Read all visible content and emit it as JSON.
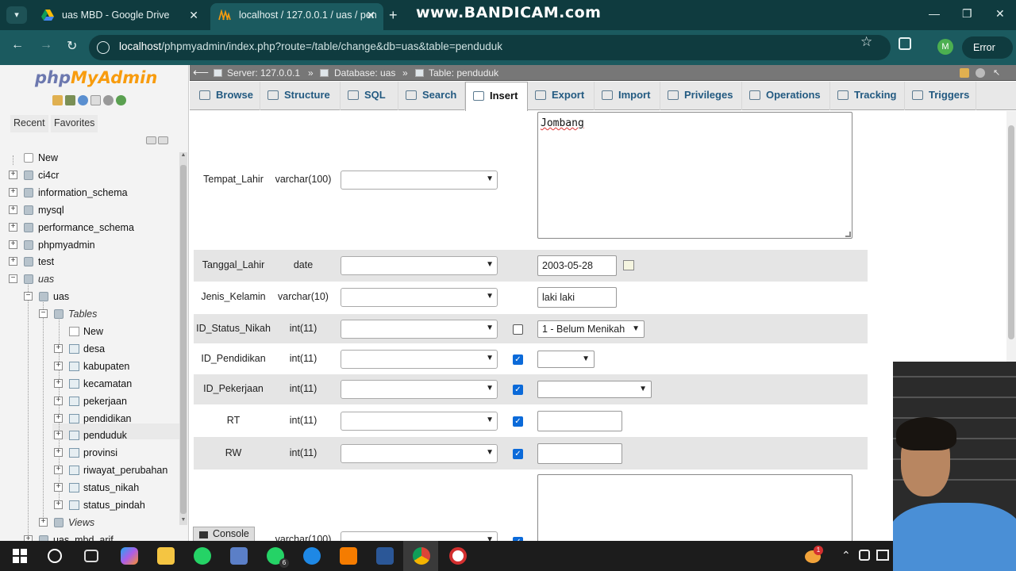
{
  "browser": {
    "tabs": [
      {
        "title": "uas MBD - Google Drive",
        "active": false
      },
      {
        "title": "localhost / 127.0.0.1 / uas / pen",
        "active": true
      }
    ],
    "watermark": "www.BANDICAM.com",
    "url_host": "localhost",
    "url_path": "/phpmyadmin/index.php?route=/table/change&db=uas&table=penduduk",
    "profile_initial": "M",
    "error_label": "Error"
  },
  "sidebar": {
    "logo_php": "php",
    "logo_my": "MyAdmin",
    "tabs": [
      "Recent",
      "Favorites"
    ],
    "tree": [
      {
        "label": "New",
        "level": 0
      },
      {
        "label": "ci4cr",
        "level": 0
      },
      {
        "label": "information_schema",
        "level": 0
      },
      {
        "label": "mysql",
        "level": 0
      },
      {
        "label": "performance_schema",
        "level": 0
      },
      {
        "label": "phpmyadmin",
        "level": 0
      },
      {
        "label": "test",
        "level": 0
      },
      {
        "label": "uas",
        "level": 0,
        "italic": true
      },
      {
        "label": "uas",
        "level": 1
      },
      {
        "label": "Tables",
        "level": 2,
        "italic": true
      },
      {
        "label": "New",
        "level": 3
      },
      {
        "label": "desa",
        "level": 3
      },
      {
        "label": "kabupaten",
        "level": 3
      },
      {
        "label": "kecamatan",
        "level": 3
      },
      {
        "label": "pekerjaan",
        "level": 3
      },
      {
        "label": "pendidikan",
        "level": 3
      },
      {
        "label": "penduduk",
        "level": 3,
        "selected": true
      },
      {
        "label": "provinsi",
        "level": 3
      },
      {
        "label": "riwayat_perubahan",
        "level": 3
      },
      {
        "label": "status_nikah",
        "level": 3
      },
      {
        "label": "status_pindah",
        "level": 3
      },
      {
        "label": "Views",
        "level": 2,
        "italic": true
      },
      {
        "label": "uas_mbd_arif",
        "level": 1
      }
    ]
  },
  "breadcrumb": {
    "server": "Server: 127.0.0.1",
    "database": "Database: uas",
    "table": "Table: penduduk",
    "sep": "»"
  },
  "tabs": [
    "Browse",
    "Structure",
    "SQL",
    "Search",
    "Insert",
    "Export",
    "Import",
    "Privileges",
    "Operations",
    "Tracking",
    "Triggers"
  ],
  "active_tab": "Insert",
  "form_rows": [
    {
      "name": "Tempat_Lahir",
      "type": "varchar(100)",
      "null": null,
      "value": "Jombang",
      "kind": "textarea"
    },
    {
      "name": "Tanggal_Lahir",
      "type": "date",
      "null": null,
      "value": "2003-05-28",
      "kind": "date"
    },
    {
      "name": "Jenis_Kelamin",
      "type": "varchar(10)",
      "null": null,
      "value": "laki laki",
      "kind": "text"
    },
    {
      "name": "ID_Status_Nikah",
      "type": "int(11)",
      "null": false,
      "value": "1 - Belum Menikah",
      "kind": "select"
    },
    {
      "name": "ID_Pendidikan",
      "type": "int(11)",
      "null": true,
      "value": "",
      "kind": "select-small"
    },
    {
      "name": "ID_Pekerjaan",
      "type": "int(11)",
      "null": true,
      "value": "",
      "kind": "select-mid"
    },
    {
      "name": "RT",
      "type": "int(11)",
      "null": true,
      "value": "",
      "kind": "text"
    },
    {
      "name": "RW",
      "type": "int(11)",
      "null": true,
      "value": "",
      "kind": "text"
    },
    {
      "name": "",
      "type": "varchar(100)",
      "null": true,
      "value": "",
      "kind": "textarea"
    }
  ],
  "console_label": "Console",
  "taskbar": {
    "whatsapp_badge": "6",
    "weather_badge": "1"
  },
  "colors": {
    "browser_dark": "#0f3b3f",
    "browser_mid": "#1b5a5f",
    "tab_link": "#235a81",
    "checkbox_blue": "#0b6ad9"
  }
}
